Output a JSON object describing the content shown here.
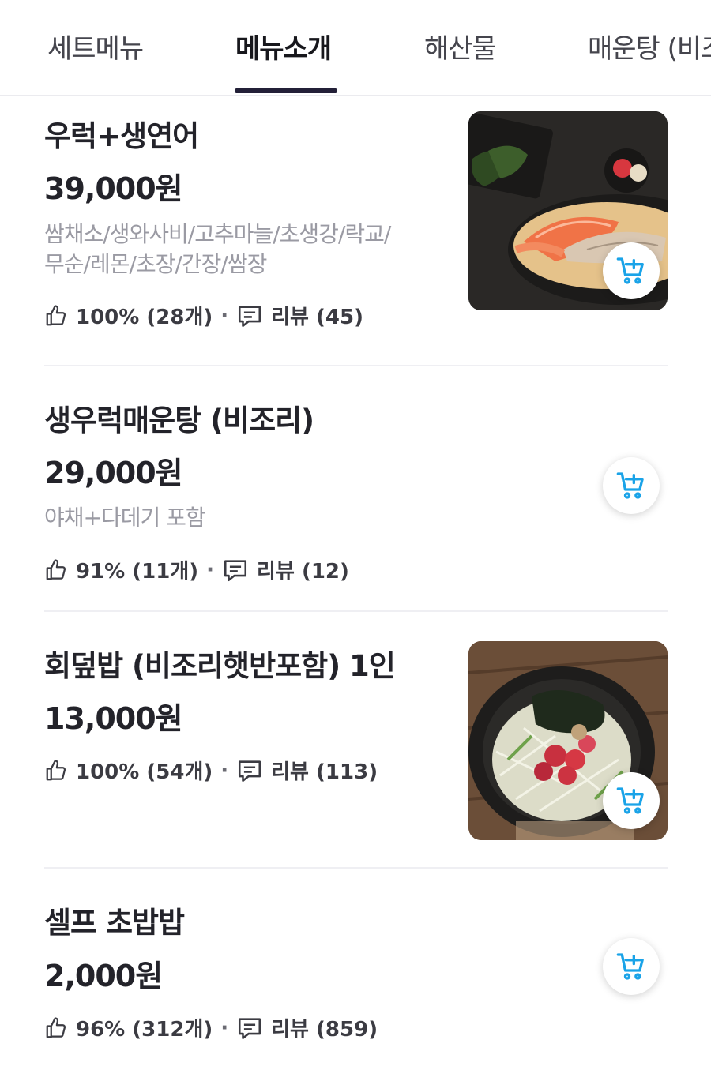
{
  "tabs": [
    {
      "label": "세트메뉴"
    },
    {
      "label": "메뉴소개"
    },
    {
      "label": "해산물"
    },
    {
      "label": "매운탕 (비조"
    }
  ],
  "items": [
    {
      "name": "우럭+생연어",
      "price": "39,000원",
      "desc_line1": "쌈채소/생와사비/고추마늘/초생강/락교/",
      "desc_line2": "무순/레몬/초장/간장/쌈장",
      "like": "100% (28개)",
      "review": "리뷰 (45)"
    },
    {
      "name": "생우럭매운탕 (비조리)",
      "price": "29,000원",
      "desc_line1": "야채+다데기 포함",
      "like": "91% (11개)",
      "review": "리뷰 (12)"
    },
    {
      "name": "회덮밥 (비조리햇반포함) 1인",
      "price": "13,000원",
      "like": "100% (54개)",
      "review": "리뷰 (113)"
    },
    {
      "name": "셀프 초밥밥",
      "price": "2,000원",
      "like": "96% (312개)",
      "review": "리뷰 (859)"
    }
  ],
  "sep": "·",
  "colors": {
    "accent_cart": "#1aa3e8",
    "tab_underline": "#232038"
  },
  "icons": [
    "thumbs-up-icon",
    "review-icon",
    "cart-plus-icon"
  ]
}
